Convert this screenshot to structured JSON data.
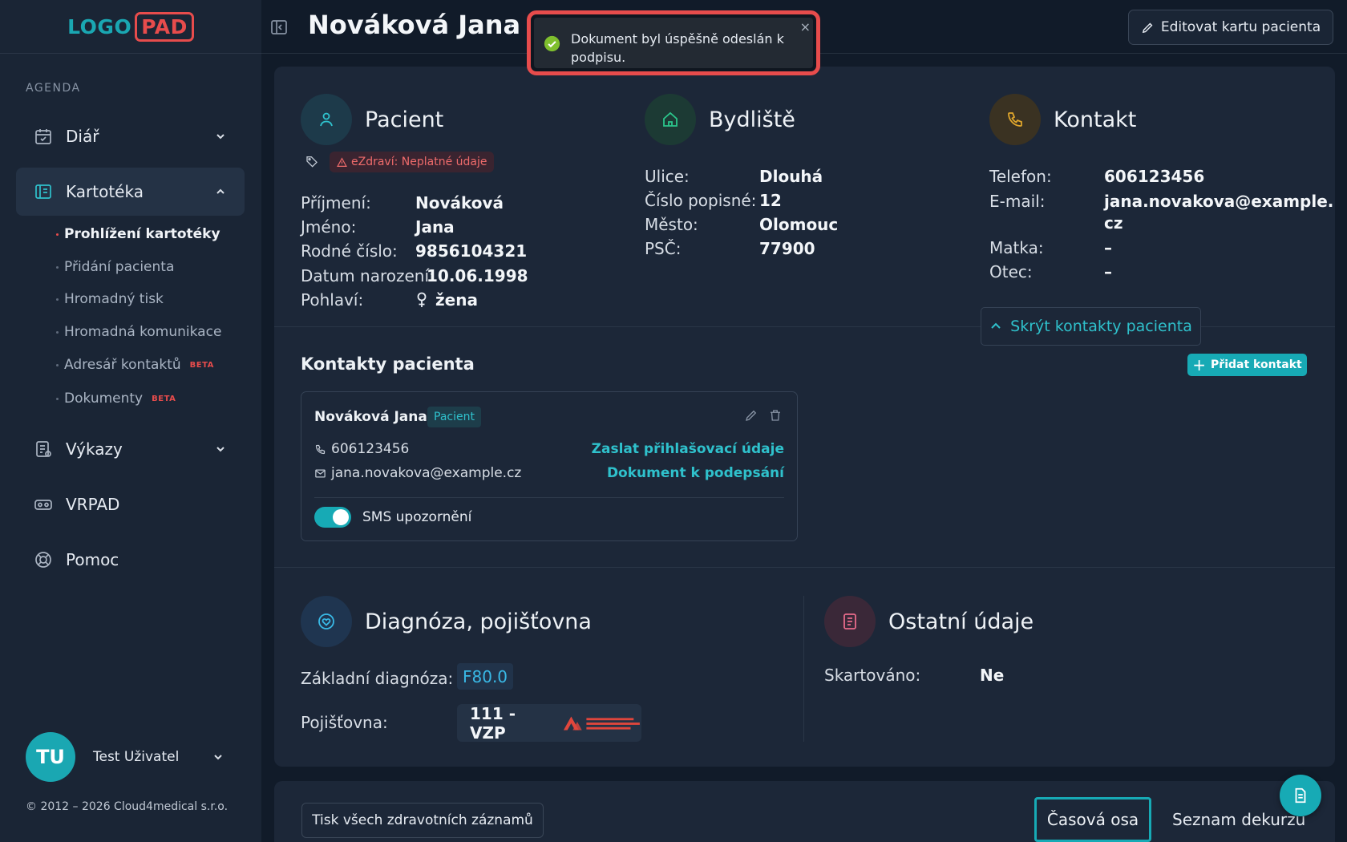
{
  "app": {
    "logo_part_a": "LOGO",
    "logo_part_b": "PAD",
    "accent_color": "#17aab5",
    "brand_red": "#e74c4c"
  },
  "sidebar": {
    "section_label": "AGENDA",
    "items": [
      {
        "label": "Diář",
        "icon": "calendar-check-icon"
      },
      {
        "label": "Kartotéka",
        "icon": "card-index-icon"
      },
      {
        "label": "Výkazy",
        "icon": "report-icon"
      },
      {
        "label": "VRPAD",
        "icon": "vr-headset-icon"
      },
      {
        "label": "Pomoc",
        "icon": "lifebuoy-icon"
      }
    ],
    "subitems": [
      {
        "label": "Prohlížení kartotéky"
      },
      {
        "label": "Přidání pacienta"
      },
      {
        "label": "Hromadný tisk"
      },
      {
        "label": "Hromadná komunikace"
      },
      {
        "label": "Adresář kontaktů",
        "badge": "BETA"
      },
      {
        "label": "Dokumenty",
        "badge": "BETA"
      }
    ],
    "user": {
      "initials": "TU",
      "name": "Test Uživatel"
    },
    "copyright": "© 2012 – 2026 Cloud4medical s.r.o."
  },
  "header": {
    "title": "Nováková Jana",
    "edit_button": "Editovat kartu pacienta"
  },
  "toast": {
    "message": "Dokument byl úspěšně odeslán k podpisu.",
    "close": "×"
  },
  "patient": {
    "title": "Pacient",
    "warning_badge": "eZdraví: Neplatné údaje",
    "fields": [
      {
        "label": "Příjmení:",
        "value": "Nováková"
      },
      {
        "label": "Jméno:",
        "value": "Jana"
      },
      {
        "label": "Rodné číslo:",
        "value": "9856104321"
      },
      {
        "label": "Datum narození:",
        "value": "10.06.1998"
      },
      {
        "label": "Pohlaví:",
        "value": "žena"
      }
    ]
  },
  "address": {
    "title": "Bydliště",
    "fields": [
      {
        "label": "Ulice:",
        "value": "Dlouhá"
      },
      {
        "label": "Číslo popisné:",
        "value": "12"
      },
      {
        "label": "Město:",
        "value": "Olomouc"
      },
      {
        "label": "PSČ:",
        "value": "77900"
      }
    ]
  },
  "contact": {
    "title": "Kontakt",
    "fields": [
      {
        "label": "Telefon:",
        "value": "606123456"
      },
      {
        "label": "E-mail:",
        "value": "jana.novakova@example.",
        "value2": "cz"
      },
      {
        "label": "Matka:",
        "value": "–"
      },
      {
        "label": "Otec:",
        "value": "–"
      }
    ],
    "hide_button": "Skrýt kontakty pacienta"
  },
  "patient_contacts": {
    "title": "Kontakty pacienta",
    "add_button": "Přidat kontakt",
    "card": {
      "name": "Nováková Jana",
      "badge": "Pacient",
      "phone": "606123456",
      "email": "jana.novakova@example.cz",
      "link_send_login": "Zaslat přihlašovací údaje",
      "link_sign_doc": "Dokument k podepsání",
      "sms_label": "SMS upozornění",
      "sms_enabled": true
    }
  },
  "diagnosis": {
    "title": "Diagnóza, pojišťovna",
    "base_label": "Základní diagnóza:",
    "base_value": "F80.0",
    "insurer_label": "Pojišťovna:",
    "insurer_value": "111 - VZP"
  },
  "other": {
    "title": "Ostatní údaje",
    "shredded_label": "Skartováno:",
    "shredded_value": "Ne"
  },
  "bottom": {
    "print_button": "Tisk všech zdravotních záznamů",
    "tab_timeline": "Časová osa",
    "tab_decursus": "Seznam dekurzů"
  }
}
